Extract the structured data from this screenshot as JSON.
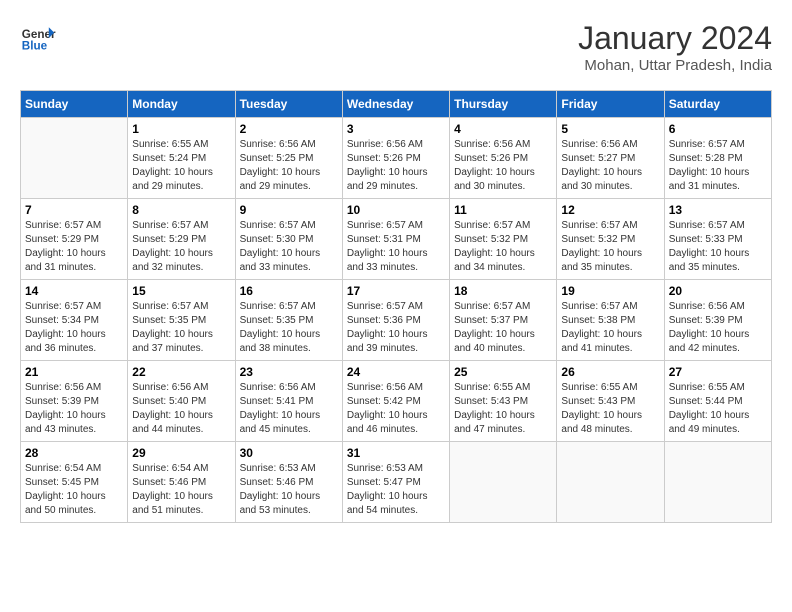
{
  "header": {
    "logo_line1": "General",
    "logo_line2": "Blue",
    "month_title": "January 2024",
    "location": "Mohan, Uttar Pradesh, India"
  },
  "days_of_week": [
    "Sunday",
    "Monday",
    "Tuesday",
    "Wednesday",
    "Thursday",
    "Friday",
    "Saturday"
  ],
  "weeks": [
    [
      {
        "day": "",
        "empty": true
      },
      {
        "day": "1",
        "sunrise": "6:55 AM",
        "sunset": "5:24 PM",
        "daylight": "10 hours and 29 minutes."
      },
      {
        "day": "2",
        "sunrise": "6:56 AM",
        "sunset": "5:25 PM",
        "daylight": "10 hours and 29 minutes."
      },
      {
        "day": "3",
        "sunrise": "6:56 AM",
        "sunset": "5:26 PM",
        "daylight": "10 hours and 29 minutes."
      },
      {
        "day": "4",
        "sunrise": "6:56 AM",
        "sunset": "5:26 PM",
        "daylight": "10 hours and 30 minutes."
      },
      {
        "day": "5",
        "sunrise": "6:56 AM",
        "sunset": "5:27 PM",
        "daylight": "10 hours and 30 minutes."
      },
      {
        "day": "6",
        "sunrise": "6:57 AM",
        "sunset": "5:28 PM",
        "daylight": "10 hours and 31 minutes."
      }
    ],
    [
      {
        "day": "7",
        "sunrise": "6:57 AM",
        "sunset": "5:29 PM",
        "daylight": "10 hours and 31 minutes."
      },
      {
        "day": "8",
        "sunrise": "6:57 AM",
        "sunset": "5:29 PM",
        "daylight": "10 hours and 32 minutes."
      },
      {
        "day": "9",
        "sunrise": "6:57 AM",
        "sunset": "5:30 PM",
        "daylight": "10 hours and 33 minutes."
      },
      {
        "day": "10",
        "sunrise": "6:57 AM",
        "sunset": "5:31 PM",
        "daylight": "10 hours and 33 minutes."
      },
      {
        "day": "11",
        "sunrise": "6:57 AM",
        "sunset": "5:32 PM",
        "daylight": "10 hours and 34 minutes."
      },
      {
        "day": "12",
        "sunrise": "6:57 AM",
        "sunset": "5:32 PM",
        "daylight": "10 hours and 35 minutes."
      },
      {
        "day": "13",
        "sunrise": "6:57 AM",
        "sunset": "5:33 PM",
        "daylight": "10 hours and 35 minutes."
      }
    ],
    [
      {
        "day": "14",
        "sunrise": "6:57 AM",
        "sunset": "5:34 PM",
        "daylight": "10 hours and 36 minutes."
      },
      {
        "day": "15",
        "sunrise": "6:57 AM",
        "sunset": "5:35 PM",
        "daylight": "10 hours and 37 minutes."
      },
      {
        "day": "16",
        "sunrise": "6:57 AM",
        "sunset": "5:35 PM",
        "daylight": "10 hours and 38 minutes."
      },
      {
        "day": "17",
        "sunrise": "6:57 AM",
        "sunset": "5:36 PM",
        "daylight": "10 hours and 39 minutes."
      },
      {
        "day": "18",
        "sunrise": "6:57 AM",
        "sunset": "5:37 PM",
        "daylight": "10 hours and 40 minutes."
      },
      {
        "day": "19",
        "sunrise": "6:57 AM",
        "sunset": "5:38 PM",
        "daylight": "10 hours and 41 minutes."
      },
      {
        "day": "20",
        "sunrise": "6:56 AM",
        "sunset": "5:39 PM",
        "daylight": "10 hours and 42 minutes."
      }
    ],
    [
      {
        "day": "21",
        "sunrise": "6:56 AM",
        "sunset": "5:39 PM",
        "daylight": "10 hours and 43 minutes."
      },
      {
        "day": "22",
        "sunrise": "6:56 AM",
        "sunset": "5:40 PM",
        "daylight": "10 hours and 44 minutes."
      },
      {
        "day": "23",
        "sunrise": "6:56 AM",
        "sunset": "5:41 PM",
        "daylight": "10 hours and 45 minutes."
      },
      {
        "day": "24",
        "sunrise": "6:56 AM",
        "sunset": "5:42 PM",
        "daylight": "10 hours and 46 minutes."
      },
      {
        "day": "25",
        "sunrise": "6:55 AM",
        "sunset": "5:43 PM",
        "daylight": "10 hours and 47 minutes."
      },
      {
        "day": "26",
        "sunrise": "6:55 AM",
        "sunset": "5:43 PM",
        "daylight": "10 hours and 48 minutes."
      },
      {
        "day": "27",
        "sunrise": "6:55 AM",
        "sunset": "5:44 PM",
        "daylight": "10 hours and 49 minutes."
      }
    ],
    [
      {
        "day": "28",
        "sunrise": "6:54 AM",
        "sunset": "5:45 PM",
        "daylight": "10 hours and 50 minutes."
      },
      {
        "day": "29",
        "sunrise": "6:54 AM",
        "sunset": "5:46 PM",
        "daylight": "10 hours and 51 minutes."
      },
      {
        "day": "30",
        "sunrise": "6:53 AM",
        "sunset": "5:46 PM",
        "daylight": "10 hours and 53 minutes."
      },
      {
        "day": "31",
        "sunrise": "6:53 AM",
        "sunset": "5:47 PM",
        "daylight": "10 hours and 54 minutes."
      },
      {
        "day": "",
        "empty": true
      },
      {
        "day": "",
        "empty": true
      },
      {
        "day": "",
        "empty": true
      }
    ]
  ]
}
